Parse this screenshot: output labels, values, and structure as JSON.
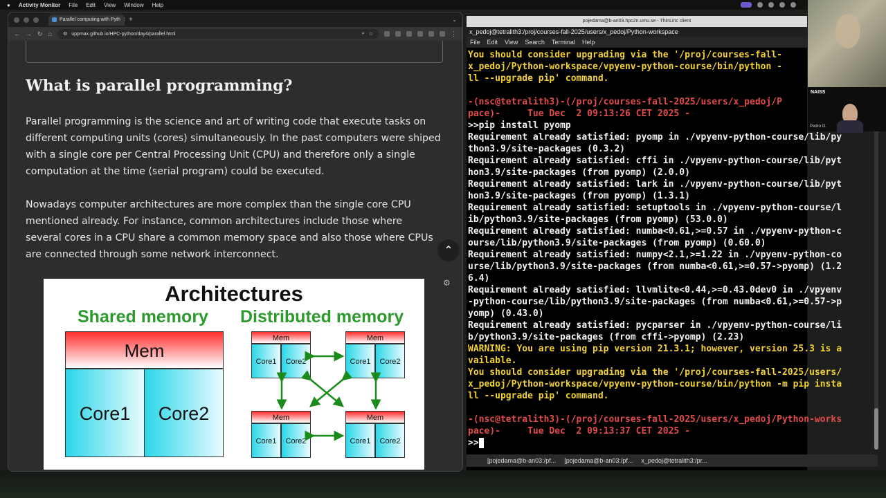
{
  "menubar": {
    "app": "Activity Monitor",
    "items": [
      "File",
      "Edit",
      "View",
      "Window",
      "Help"
    ]
  },
  "browser": {
    "tab_title": "Parallel computing with Pyth",
    "url": "uppmax.github.io/HPC-python/day4/parallel.html",
    "heading": "What is parallel programming?",
    "para1": "Parallel programming is the science and art of writing code that execute tasks on different computing units (cores) simultaneously. In the past computers were shiped with a single core per Central Processing Unit (CPU) and therefore only a single computation at the time (serial program) could be executed.",
    "para2": "Nowadays computer architectures are more complex than the single core CPU mentioned already. For instance, common architectures include those where several cores in a CPU share a common memory space and also those where CPUs are connected through some network interconnect.",
    "figure": {
      "title": "Architectures",
      "shared_label": "Shared memory",
      "distributed_label": "Distributed memory",
      "mem": "Mem",
      "core1": "Core1",
      "core2": "Core2"
    }
  },
  "terminal": {
    "window_title": "pojedama@b-an03.hpc2n.umu.se - ThinLinc client",
    "tab_title": "x_pedoj@tetralith3:/proj/courses-fall-2025/users/x_pedoj/Python-workspace",
    "menu": [
      "File",
      "Edit",
      "View",
      "Search",
      "Terminal",
      "Help"
    ],
    "lines": [
      {
        "c": "y",
        "t": "You should consider upgrading via the '/proj/courses-fall-"
      },
      {
        "c": "y",
        "t": "x_pedoj/Python-workspace/vpyenv-python-course/bin/python -"
      },
      {
        "c": "y",
        "t": "ll --upgrade pip' command."
      },
      {
        "c": "w",
        "t": ""
      },
      {
        "c": "r",
        "t": "-(nsc@tetralith3)-(/proj/courses-fall-2025/users/x_pedoj/P"
      },
      {
        "c": "r",
        "t": "pace)-     Tue Dec  2 09:13:26 CET 2025 -"
      },
      {
        "c": "w",
        "t": ">>pip install pyomp"
      },
      {
        "c": "w",
        "t": "Requirement already satisfied: pyomp in ./vpyenv-python-course/lib/py"
      },
      {
        "c": "w",
        "t": "thon3.9/site-packages (0.3.2)"
      },
      {
        "c": "w",
        "t": "Requirement already satisfied: cffi in ./vpyenv-python-course/lib/pyt"
      },
      {
        "c": "w",
        "t": "hon3.9/site-packages (from pyomp) (2.0.0)"
      },
      {
        "c": "w",
        "t": "Requirement already satisfied: lark in ./vpyenv-python-course/lib/pyt"
      },
      {
        "c": "w",
        "t": "hon3.9/site-packages (from pyomp) (1.3.1)"
      },
      {
        "c": "w",
        "t": "Requirement already satisfied: setuptools in ./vpyenv-python-course/l"
      },
      {
        "c": "w",
        "t": "ib/python3.9/site-packages (from pyomp) (53.0.0)"
      },
      {
        "c": "w",
        "t": "Requirement already satisfied: numba<0.61,>=0.57 in ./vpyenv-python-c"
      },
      {
        "c": "w",
        "t": "ourse/lib/python3.9/site-packages (from pyomp) (0.60.0)"
      },
      {
        "c": "w",
        "t": "Requirement already satisfied: numpy<2.1,>=1.22 in ./vpyenv-python-co"
      },
      {
        "c": "w",
        "t": "urse/lib/python3.9/site-packages (from numba<0.61,>=0.57->pyomp) (1.2"
      },
      {
        "c": "w",
        "t": "6.4)"
      },
      {
        "c": "w",
        "t": "Requirement already satisfied: llvmlite<0.44,>=0.43.0dev0 in ./vpyenv"
      },
      {
        "c": "w",
        "t": "-python-course/lib/python3.9/site-packages (from numba<0.61,>=0.57->p"
      },
      {
        "c": "w",
        "t": "yomp) (0.43.0)"
      },
      {
        "c": "w",
        "t": "Requirement already satisfied: pycparser in ./vpyenv-python-course/li"
      },
      {
        "c": "w",
        "t": "b/python3.9/site-packages (from cffi->pyomp) (2.23)"
      },
      {
        "c": "y",
        "t": "WARNING: You are using pip version 21.3.1; however, version 25.3 is a"
      },
      {
        "c": "y",
        "t": "vailable."
      },
      {
        "c": "y",
        "t": "You should consider upgrading via the '/proj/courses-fall-2025/users/"
      },
      {
        "c": "y",
        "t": "x_pedoj/Python-workspace/vpyenv-python-course/bin/python -m pip insta"
      },
      {
        "c": "y",
        "t": "ll --upgrade pip' command."
      },
      {
        "c": "w",
        "t": ""
      },
      {
        "c": "r",
        "t": "-(nsc@tetralith3)-(/proj/courses-fall-2025/users/x_pedoj/Python-works"
      },
      {
        "c": "r",
        "t": "pace)-     Tue Dec  2 09:13:37 CET 2025 -"
      }
    ],
    "prompt": ">>",
    "taskbar": [
      "[pojedama@b-an03:/pf...",
      "[pojedama@b-an03:/pf...",
      "x_pedoj@tetralith3:/pr..."
    ]
  },
  "video": {
    "cam2_logo": "NAISS",
    "cam2_name": "Pedro O."
  }
}
